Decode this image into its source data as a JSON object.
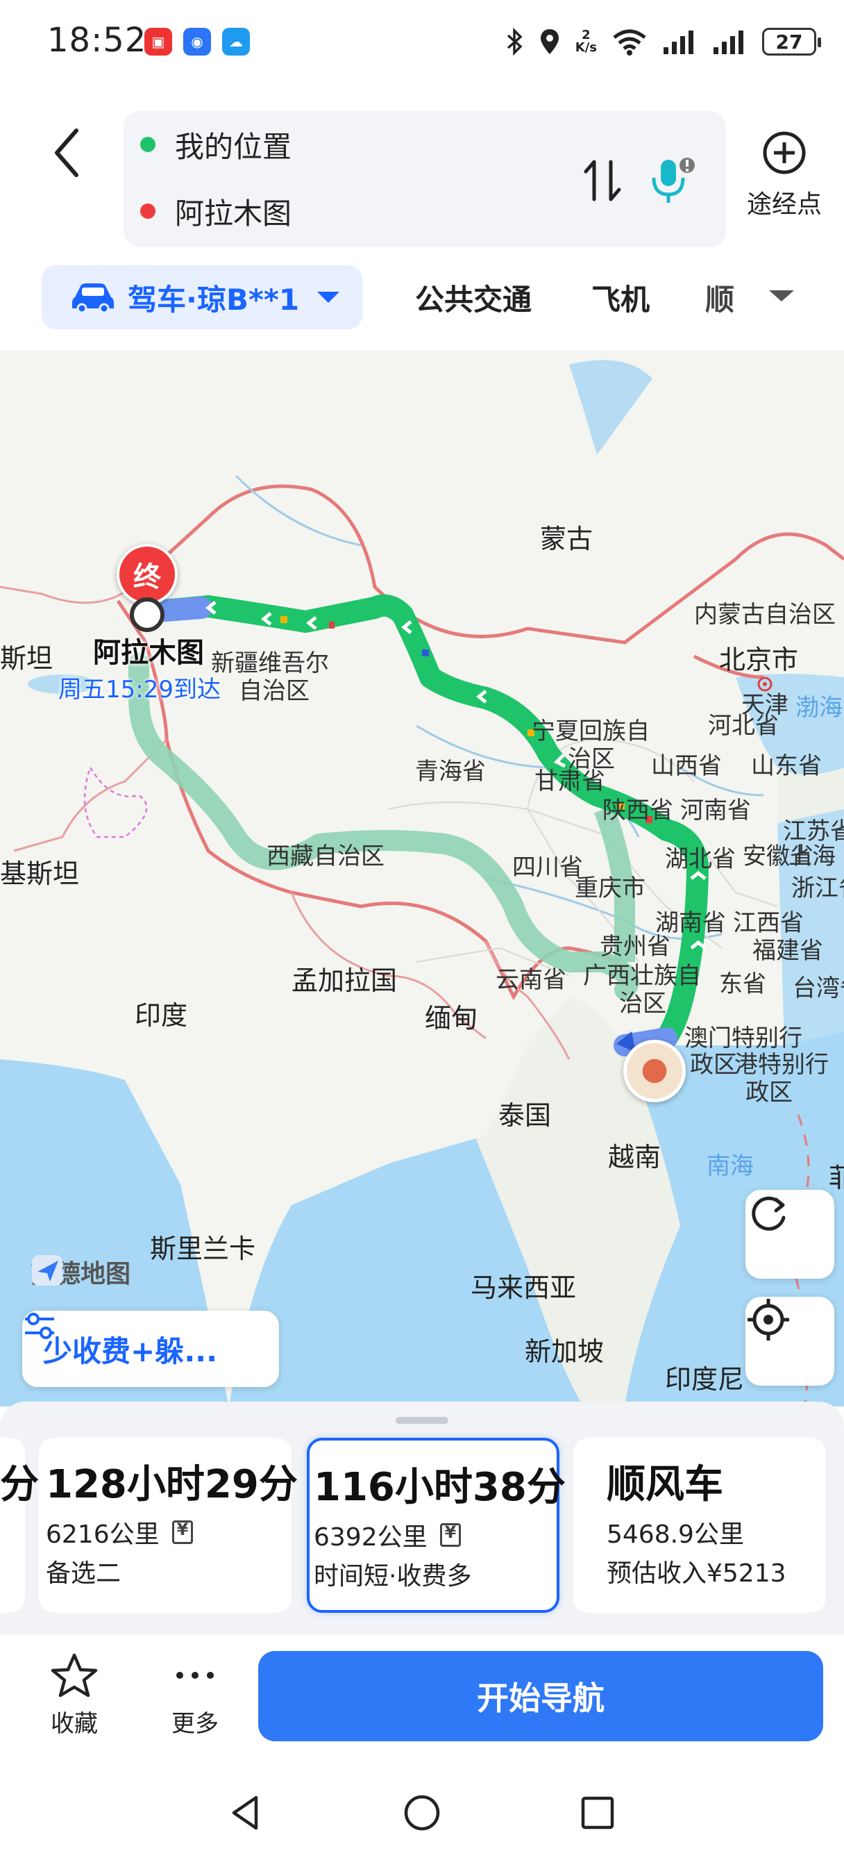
{
  "status_bar": {
    "time": "18:52",
    "net_speed_value": "2",
    "net_speed_unit": "K/s",
    "battery": "27",
    "icons": [
      "huawei-app-icon",
      "blue-app-icon",
      "cloud-app-icon",
      "bluetooth-icon",
      "location-icon",
      "wifi-icon",
      "signal-icon",
      "signal-icon-2"
    ]
  },
  "header": {
    "origin": "我的位置",
    "destination": "阿拉木图",
    "waypoint_label": "途经点",
    "origin_color": "#1fc36a",
    "destination_color": "#ef3b3b"
  },
  "modes": {
    "active": "驾车·琼B**1",
    "tabs": [
      "公共交通",
      "飞机",
      "顺"
    ]
  },
  "map": {
    "destination_pin": "终",
    "destination_name": "阿拉木图",
    "eta": "周五15:29到达",
    "labels": {
      "mongolia": "蒙古",
      "inner_mongolia": "内蒙古自治区",
      "xinjiang_1": "新疆维吾尔",
      "xinjiang_2": "自治区",
      "beijing": "北京市",
      "tianjin": "天津",
      "bohai": "渤海",
      "hebei": "河北省",
      "ningxia_1": "宁夏回族自",
      "ningxia_2": "治区",
      "shanxi": "山西省",
      "shandong": "山东省",
      "qinghai": "青海省",
      "gansu": "甘肃省",
      "shaanxi": "陕西省",
      "henan": "河南省",
      "jiangsu": "江苏省",
      "xizang": "西藏自治区",
      "sichuan": "四川省",
      "hubei": "湖北省",
      "anhui": "安徽省",
      "shanghai": "上海",
      "chongqing": "重庆市",
      "zhejiang": "浙江省",
      "hunan": "湖南省",
      "jiangxi": "江西省",
      "guizhou": "贵州省",
      "fujian": "福建省",
      "guangxi_1": "广西壮族自",
      "guangxi_2": "治区",
      "guangdong": "东省",
      "taiwan": "台湾省",
      "yunnan": "云南省",
      "macau_1": "澳门特别行",
      "macau_2": "政区",
      "hongkong_1": "港特别行",
      "hongkong_2": "政区",
      "bangladesh": "孟加拉国",
      "myanmar": "缅甸",
      "india": "印度",
      "thailand": "泰国",
      "vietnam": "越南",
      "south_china_sea": "南海",
      "srilanka": "斯里兰卡",
      "malaysia": "马来西亚",
      "singapore": "新加坡",
      "indonesia": "印度尼",
      "pakistan": "基斯坦",
      "edge_left": "斯坦",
      "edge_right": "菲"
    },
    "logo": "高德地图",
    "filter_chip": "少收费+躲..."
  },
  "route_cards": [
    {
      "time": "分",
      "distance": "",
      "note": ""
    },
    {
      "time": "128小时29分",
      "distance": "6216公里",
      "note": "备选二",
      "toll": true
    },
    {
      "time": "116小时38分",
      "distance": "6392公里",
      "note": "时间短·收费多",
      "toll": true,
      "selected": true
    },
    {
      "time": "顺风车",
      "distance": "5468.9公里",
      "note": "预估收入¥5213"
    }
  ],
  "actions": {
    "favorite": "收藏",
    "more": "更多",
    "start": "开始导航"
  },
  "colors": {
    "accent": "#1a64ff",
    "start_button": "#2f78f6",
    "route_main": "#1fc36a",
    "route_alt": "#8fd3b4"
  }
}
